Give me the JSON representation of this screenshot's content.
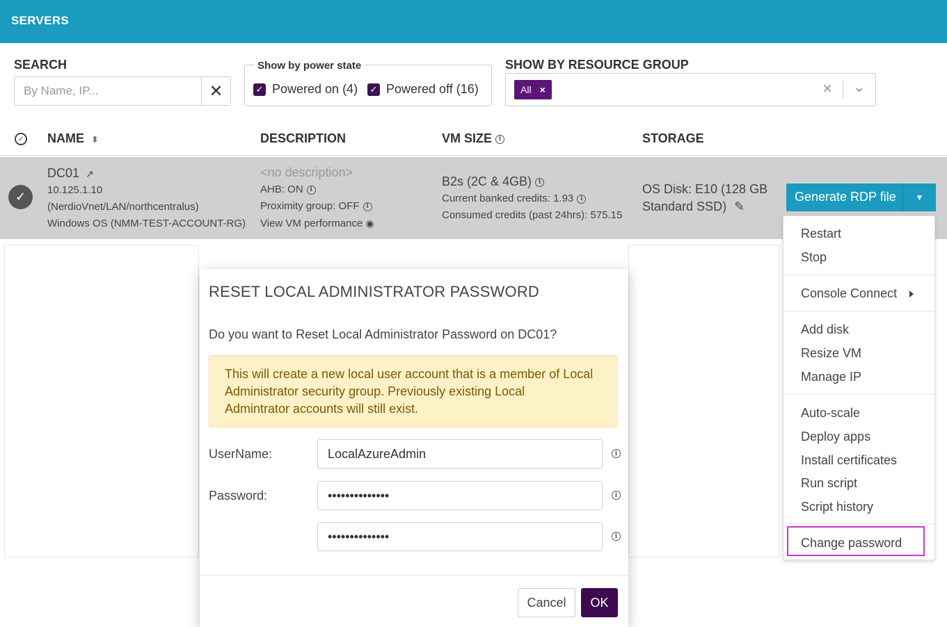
{
  "header": {
    "title": "SERVERS"
  },
  "filters": {
    "search_label": "SEARCH",
    "search_placeholder": "By Name, IP...",
    "search_clear": "✕",
    "power_legend": "Show by power state",
    "powered_on": "Powered on (4)",
    "powered_off": "Powered off (16)",
    "resource_group_label": "SHOW BY RESOURCE GROUP",
    "resource_group_tag": "All",
    "tag_remove": "×",
    "rg_clear": "×",
    "rg_caret": "⌄"
  },
  "table": {
    "headers": {
      "name": "NAME",
      "description": "DESCRIPTION",
      "vm_size": "VM SIZE",
      "storage": "STORAGE"
    },
    "row": {
      "name": "DC01",
      "ip": "10.125.1.10",
      "network": "(NerdioVnet/LAN/northcentralus)",
      "os": "Windows OS (NMM-TEST-ACCOUNT-RG)",
      "description": "<no description>",
      "ahb": "AHB: ON",
      "proximity": "Proximity group: OFF",
      "performance": "View VM performance",
      "size": "B2s (2C & 4GB)",
      "banked": "Current banked credits: 1.93",
      "consumed": "Consumed credits (past 24hrs): 575.15",
      "storage_line1": "OS Disk: E10 (128 GB",
      "storage_line2": "Standard SSD)"
    }
  },
  "rdp_button": {
    "label": "Generate RDP file",
    "caret": "▼"
  },
  "menu": {
    "restart": "Restart",
    "stop": "Stop",
    "console_connect": "Console Connect",
    "add_disk": "Add disk",
    "resize_vm": "Resize VM",
    "manage_ip": "Manage IP",
    "auto_scale": "Auto-scale",
    "deploy_apps": "Deploy apps",
    "install_certificates": "Install certificates",
    "run_script": "Run script",
    "script_history": "Script history",
    "change_password": "Change password"
  },
  "modal": {
    "title": "RESET LOCAL ADMINISTRATOR PASSWORD",
    "question": "Do you want to Reset Local Administrator Password on DC01?",
    "warning_line1": "This will create a new local user account that is a member of Local",
    "warning_line2": "Administrator security group. Previously existing Local",
    "warning_line3": "Admintrator accounts will still exist.",
    "username_label": "UserName:",
    "username_value": "LocalAzureAdmin",
    "password_label": "Password:",
    "password_value": "••••••••••••••",
    "confirm_value": "••••••••••••••",
    "cancel": "Cancel",
    "ok": "OK"
  },
  "colors": {
    "header": "#1a9bbf",
    "accent_purple": "#3d0a4f",
    "tag_purple": "#5b1576",
    "highlight": "#c43bc6",
    "warning_bg": "#fdf1c8"
  }
}
